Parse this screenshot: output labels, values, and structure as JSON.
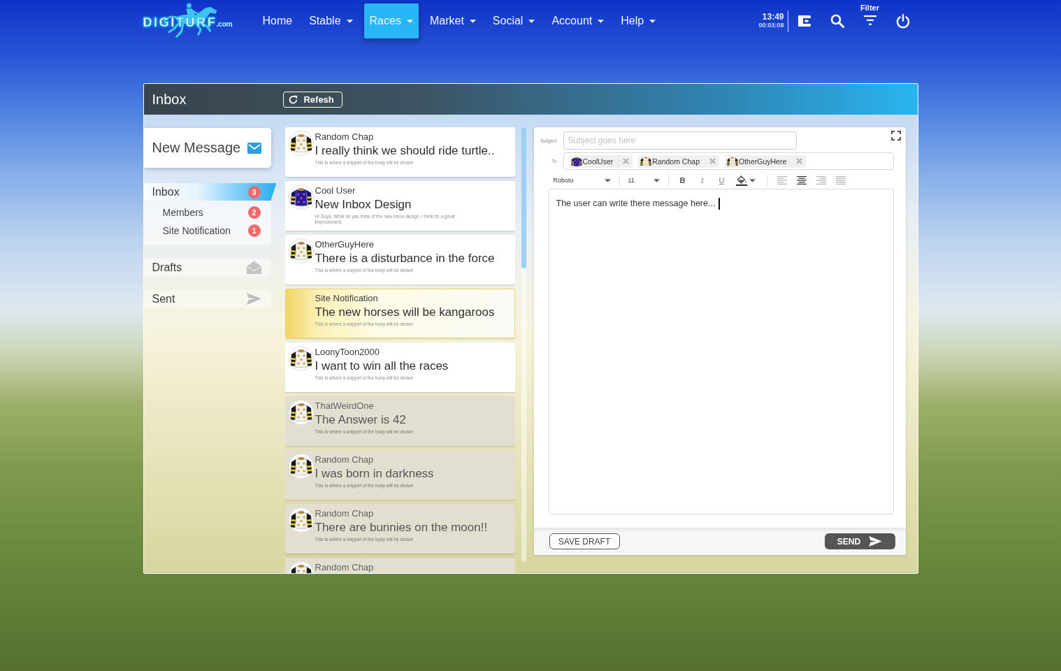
{
  "navbar": {
    "logo": {
      "name": "DIGITURF",
      "domain": ".com"
    },
    "menu": [
      {
        "label": "Home",
        "dropdown": false,
        "selected": false
      },
      {
        "label": "Stable",
        "dropdown": true,
        "selected": false
      },
      {
        "label": "Races",
        "dropdown": true,
        "selected": true
      },
      {
        "label": "Market",
        "dropdown": true,
        "selected": false
      },
      {
        "label": "Social",
        "dropdown": true,
        "selected": false
      },
      {
        "label": "Account",
        "dropdown": true,
        "selected": false
      },
      {
        "label": "Help",
        "dropdown": true,
        "selected": false
      }
    ],
    "clock": {
      "time": "13:49",
      "timer": "00:03:08"
    },
    "tools": [
      {
        "kind": "wallet"
      },
      {
        "kind": "search"
      },
      {
        "kind": "filter",
        "label": "Filter"
      },
      {
        "kind": "power"
      }
    ]
  },
  "inbox": {
    "title": "Inbox",
    "refresh_button": "Refesh"
  },
  "sidebar": {
    "new_message_button": "New Message",
    "folders": [
      {
        "kind": "inbox",
        "label": "Inbox",
        "count": "3",
        "selected": true,
        "children": [
          {
            "label": "Members",
            "count": "2",
            "selected": false
          },
          {
            "label": "Site Notification",
            "count": "1",
            "selected": false
          }
        ]
      },
      {
        "kind": "drafts",
        "label": "Drafts",
        "selected": false
      },
      {
        "kind": "sent",
        "label": "Sent",
        "selected": false
      }
    ]
  },
  "messages": [
    {
      "kind": "member",
      "sender": "Random Chap",
      "subject": "I really think we should ride turtle..",
      "snippet": "This is where a snippet of the body will be shown",
      "read": false,
      "color": "#f2f1ec"
    },
    {
      "kind": "member",
      "sender": "Cool User",
      "subject": "New Inbox Design",
      "snippet": "Hi Guys, What do you think of the new inbox design, I think its a great improvement.",
      "read": false,
      "color": "#1e1a9a"
    },
    {
      "kind": "member",
      "sender": "OtherGuyHere",
      "subject": "There is a disturbance in the force",
      "snippet": "This is where a snippet of the body will be shown",
      "read": false,
      "color": "#f2f1ec"
    },
    {
      "kind": "notification",
      "sender": "Site Notification",
      "subject": "The new horses will be kangaroos",
      "snippet": "This is where a snippet of the body will be shown",
      "read": false
    },
    {
      "kind": "member",
      "sender": "LoonyToon2000",
      "subject": "I want to win all the races",
      "snippet": "This is where a snippet of the body will be shown",
      "read": false,
      "color": "#f2f1ec"
    },
    {
      "kind": "member",
      "sender": "ThatWeirdOne",
      "subject": "The Answer is 42",
      "snippet": "This is where a snippet of the body will be shown",
      "read": true,
      "color": "#f2f1ec"
    },
    {
      "kind": "member",
      "sender": "Random Chap",
      "subject": "I was born in darkness",
      "snippet": "This is where a snippet of the body will be shown",
      "read": true,
      "color": "#f2f1ec"
    },
    {
      "kind": "member",
      "sender": "Random Chap",
      "subject": "There are bunnies on the moon!!",
      "snippet": "This is where a snippet of the body will be shown",
      "read": true,
      "color": "#f2f1ec"
    },
    {
      "kind": "member",
      "sender": "Random Chap",
      "read": true,
      "color": "#f2f1ec"
    }
  ],
  "compose": {
    "subject": {
      "label": "Subject",
      "placeholder": "Subject goes here"
    },
    "to": {
      "label": "To",
      "recipients": [
        {
          "name": "CoolUser",
          "color": "#1e1a9a"
        },
        {
          "name": "Random Chap",
          "color": "#f2f1ec"
        },
        {
          "name": "OtherGuyHere",
          "color": "#f2f1ec"
        }
      ]
    },
    "toolbar": {
      "font": "Roboto",
      "size": "11",
      "formats": [
        {
          "kind": "bold",
          "label": "B"
        },
        {
          "kind": "italic",
          "label": "I"
        },
        {
          "kind": "underline",
          "label": "U"
        }
      ],
      "alignments": [
        {
          "kind": "left",
          "selected": false
        },
        {
          "kind": "center",
          "selected": true
        },
        {
          "kind": "right",
          "selected": false
        },
        {
          "kind": "justify",
          "selected": false
        }
      ]
    },
    "body": {
      "value": "The user can write there message here..."
    },
    "save_draft_button": "SAVE DRAFT",
    "send_button": "SEND"
  }
}
